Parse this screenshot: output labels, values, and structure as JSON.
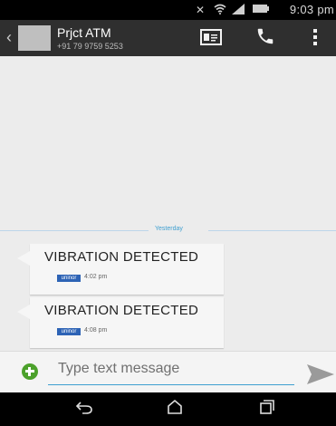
{
  "status_bar": {
    "time": "9:03 pm",
    "icons": [
      "mute-icon",
      "wifi-icon",
      "signal-icon",
      "battery-icon"
    ]
  },
  "conversation": {
    "contact_name": "Prjct ATM",
    "contact_number": "+91 79 9759 5253",
    "icons": [
      "back-icon",
      "contact-card-icon",
      "phone-icon",
      "overflow-menu-icon"
    ]
  },
  "messages": {
    "day_label": "Yesterday",
    "items": [
      {
        "text": "VIBRATION DETECTED",
        "carrier": "uninor",
        "time": "4:02 pm"
      },
      {
        "text": "VIBRATION DETECTED",
        "carrier": "uninor",
        "time": "4:08 pm"
      }
    ]
  },
  "compose": {
    "placeholder": "Type text message",
    "icons": [
      "add-attachment-icon",
      "send-icon"
    ]
  },
  "navigation": {
    "icons": [
      "back-nav-icon",
      "home-icon",
      "recent-apps-icon"
    ]
  },
  "colors": {
    "accent": "#3f9fd0",
    "status_bar": "#000000",
    "action_bar": "#2f2f2f",
    "carrier_tag": "#2d63b5",
    "add_button": "#4ca12b"
  }
}
